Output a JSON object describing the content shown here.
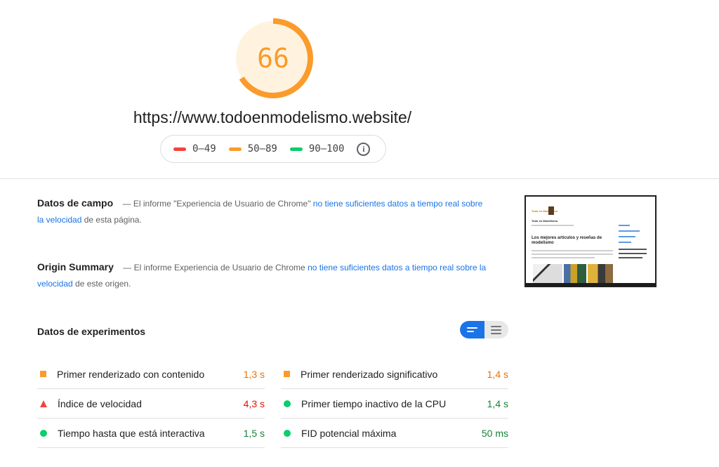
{
  "header": {
    "score": "66",
    "score_fraction": 0.66,
    "score_color": "#fa9b2b",
    "url": "https://www.todoenmodelismo.website/",
    "legend": [
      {
        "range": "0–49",
        "color": "#f4433c"
      },
      {
        "range": "50–89",
        "color": "#fa9b2b"
      },
      {
        "range": "90–100",
        "color": "#0cce6b"
      }
    ],
    "info_icon": "i"
  },
  "field_data": {
    "title": "Datos de campo",
    "text_before": "— El informe \"Experiencia de Usuario de Chrome\"",
    "link": "no tiene suficientes datos a tiempo real sobre la velocidad",
    "text_after": "de esta página."
  },
  "origin_summary": {
    "title": "Origin Summary",
    "text_before": "— El informe Experiencia de Usuario de Chrome",
    "link": "no tiene suficientes datos a tiempo real sobre la velocidad",
    "text_after": "de este origen."
  },
  "thumbnail": {
    "site_name": "Todo en Modelismo",
    "heading": "Los mejores artículos y reseñas de modelismo",
    "logo_text": "Todo en Modelismo"
  },
  "experiments": {
    "title": "Datos de experimentos",
    "metrics": [
      {
        "label": "Primer renderizado con contenido",
        "value": "1,3 s",
        "status": "average",
        "icon": "square",
        "color": "#e8710a"
      },
      {
        "label": "Primer renderizado significativo",
        "value": "1,4 s",
        "status": "average",
        "icon": "square",
        "color": "#e8710a"
      },
      {
        "label": "Índice de velocidad",
        "value": "4,3 s",
        "status": "fail",
        "icon": "triangle",
        "color": "#eb0f00"
      },
      {
        "label": "Primer tiempo inactivo de la CPU",
        "value": "1,4 s",
        "status": "pass",
        "icon": "circle",
        "color": "#188038"
      },
      {
        "label": "Tiempo hasta que está interactiva",
        "value": "1,5 s",
        "status": "pass",
        "icon": "circle",
        "color": "#188038"
      },
      {
        "label": "FID potencial máxima",
        "value": "50 ms",
        "status": "pass",
        "icon": "circle",
        "color": "#188038"
      }
    ]
  }
}
